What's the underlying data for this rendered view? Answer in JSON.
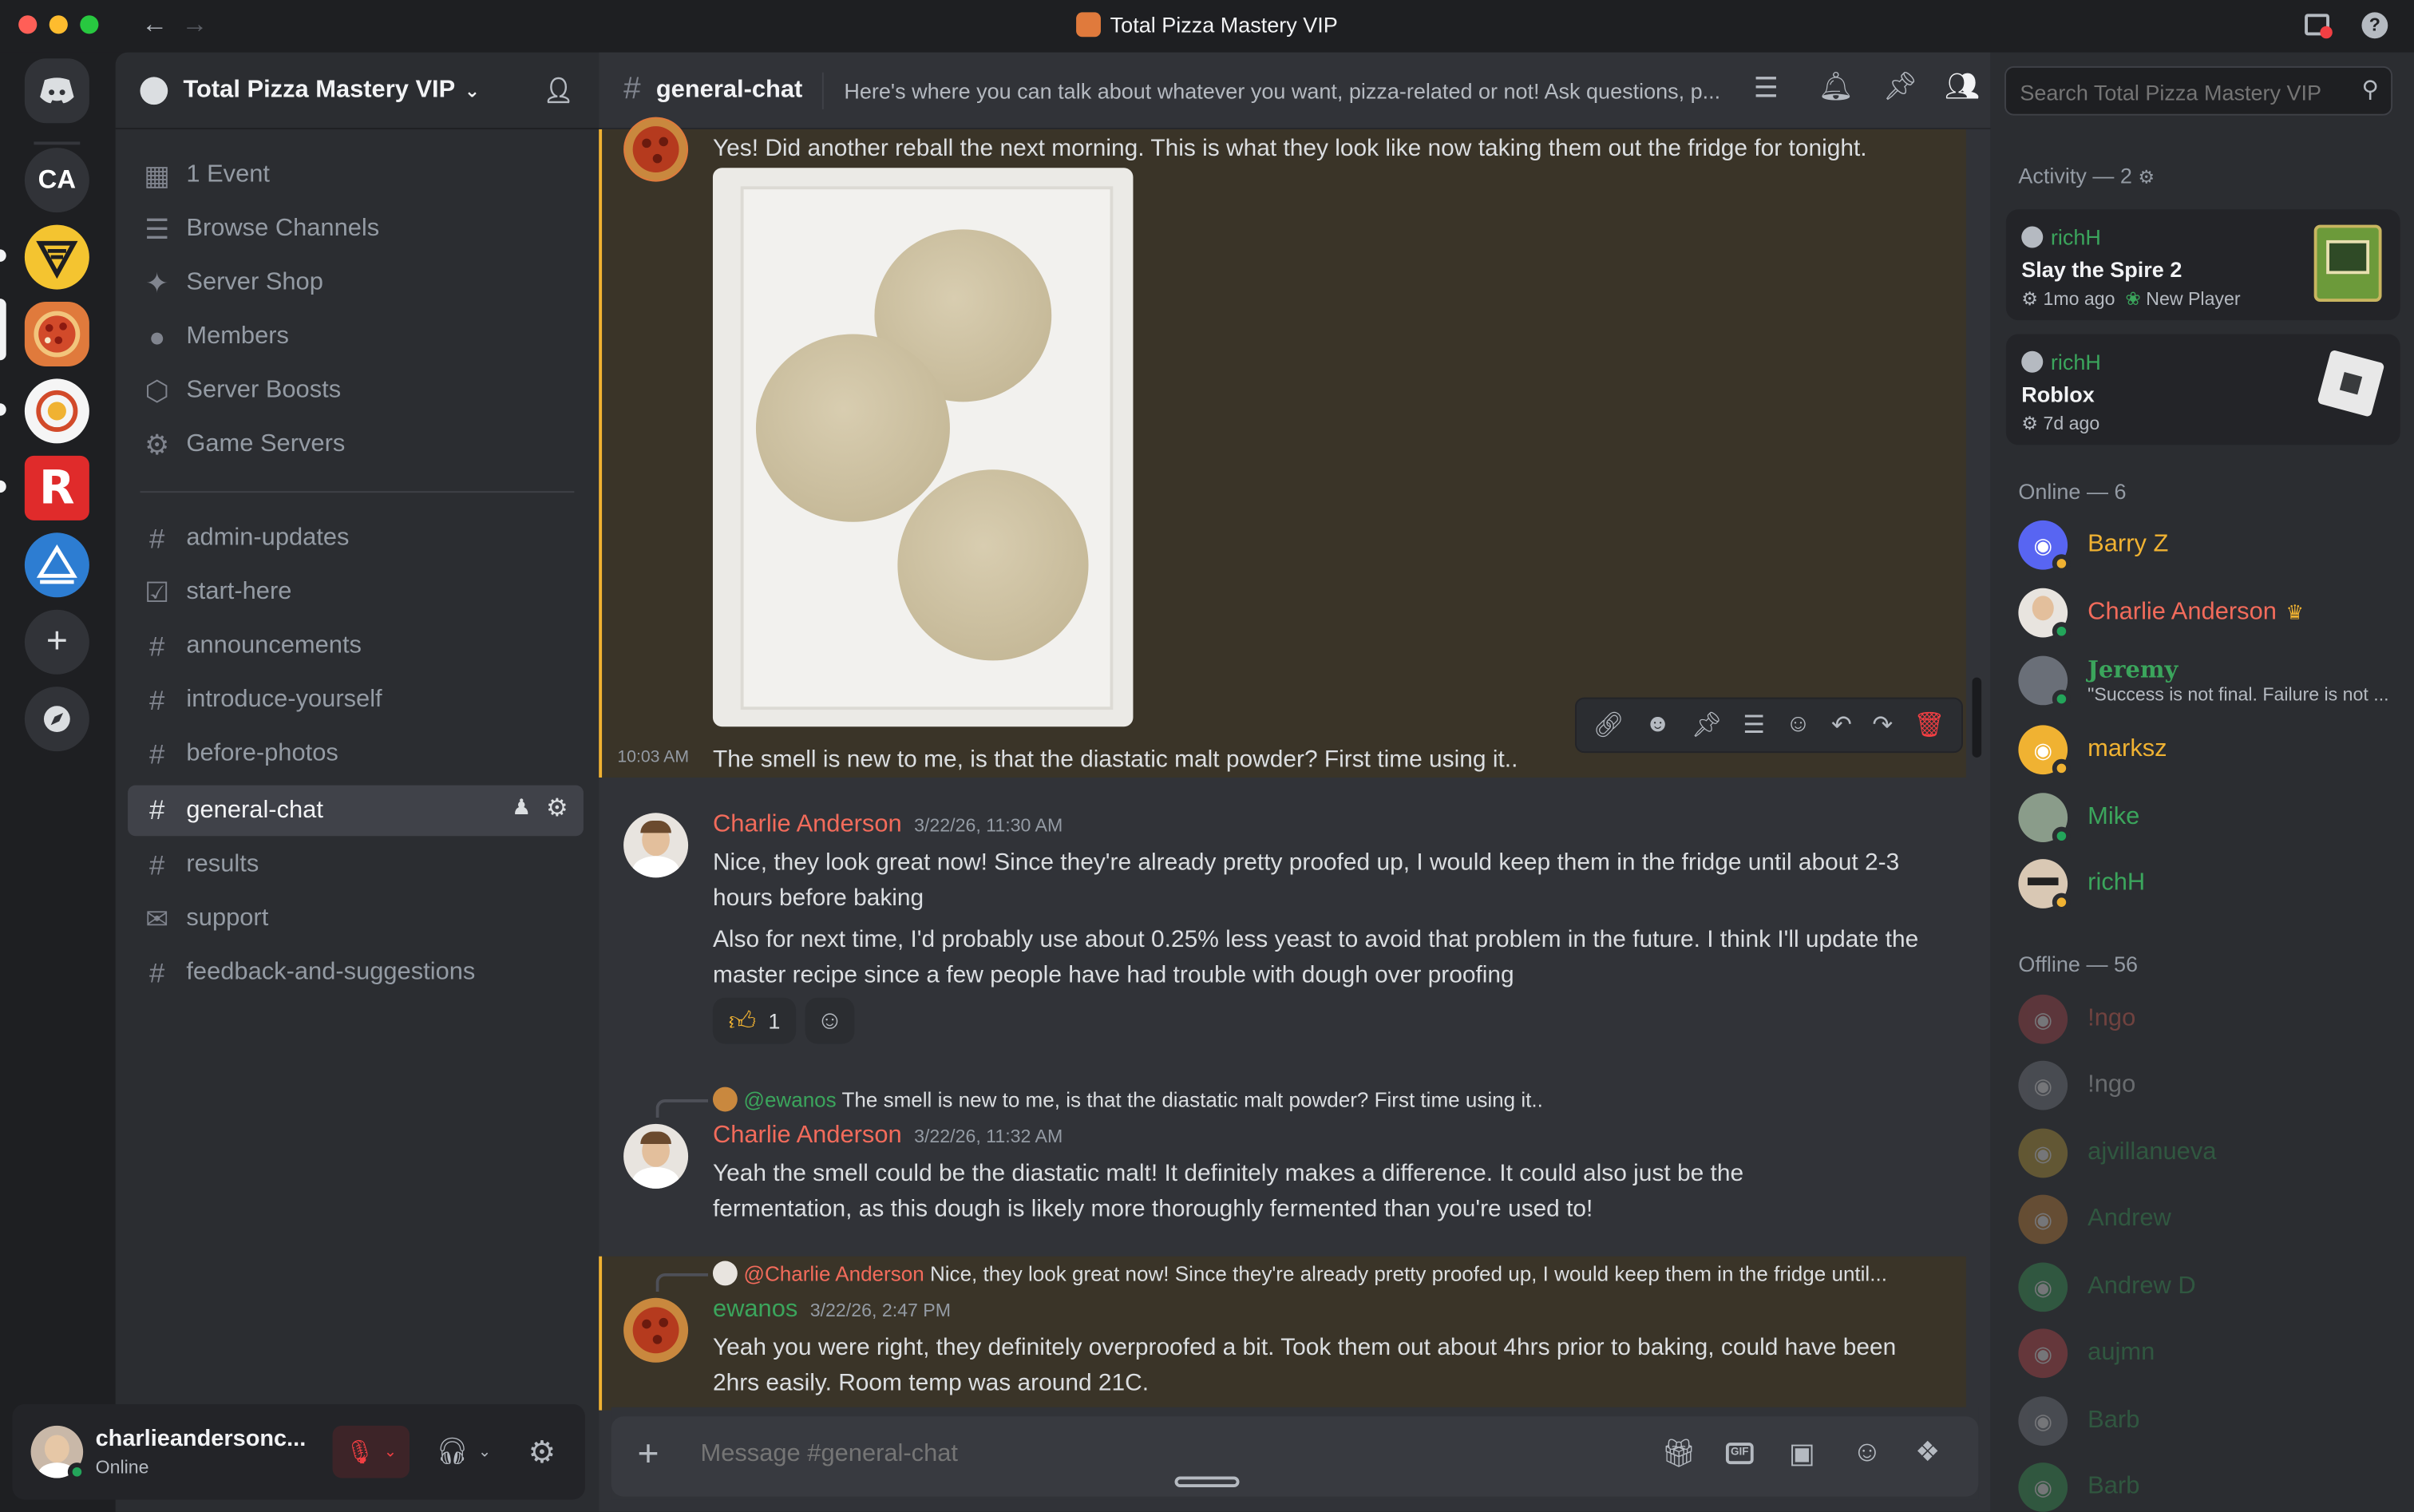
{
  "window": {
    "title": "Total Pizza Mastery VIP"
  },
  "servers": [
    {
      "name": "Discord",
      "label": ""
    },
    {
      "name": "CA",
      "label": "CA"
    },
    {
      "name": "server-3",
      "label": ""
    },
    {
      "name": "Total Pizza Mastery VIP",
      "label": ""
    },
    {
      "name": "server-5",
      "label": ""
    },
    {
      "name": "server-6",
      "label": "R"
    },
    {
      "name": "server-7",
      "label": ""
    }
  ],
  "server_header": {
    "title": "Total Pizza Mastery VIP"
  },
  "nav_items": [
    {
      "label": "1 Event",
      "icon": "calendar-icon"
    },
    {
      "label": "Browse Channels",
      "icon": "browse-icon"
    },
    {
      "label": "Server Shop",
      "icon": "shop-icon"
    },
    {
      "label": "Members",
      "icon": "members-icon"
    },
    {
      "label": "Server Boosts",
      "icon": "boost-icon"
    },
    {
      "label": "Game Servers",
      "icon": "gamepad-icon"
    }
  ],
  "channels": [
    {
      "label": "admin-updates"
    },
    {
      "label": "start-here"
    },
    {
      "label": "announcements"
    },
    {
      "label": "introduce-yourself"
    },
    {
      "label": "before-photos"
    },
    {
      "label": "general-chat"
    },
    {
      "label": "results"
    },
    {
      "label": "support"
    },
    {
      "label": "feedback-and-suggestions"
    }
  ],
  "user": {
    "name": "charlieandersonc...",
    "status": "Online"
  },
  "chat": {
    "channel": "general-chat",
    "topic": "Here's where you can talk about whatever you want, pizza-related or not! Ask questions, p...",
    "search_placeholder": "Search Total Pizza Mastery VIP",
    "composer_placeholder": "Message #general-chat"
  },
  "messages": [
    {
      "text": "Yes! Did another reball the next morning. This is what they look like now taking them out the fridge for tonight."
    },
    {
      "time": "10:03 AM",
      "text": "The smell is new to me, is that the diastatic malt powder? First time using it.."
    },
    {
      "author": "Charlie Anderson",
      "time": "3/22/26, 11:30 AM",
      "text1": "Nice, they look great now! Since they're already pretty proofed up, I would keep them in the fridge until about 2-3 hours before baking",
      "text2": "Also for next time, I'd probably use about 0.25% less yeast to avoid that problem in the future. I think I'll update the master recipe since a few people have had trouble with dough over proofing",
      "reaction_count": "1"
    },
    {
      "reply_user": "@ewanos",
      "reply_text": "The smell is new to me, is that the diastatic malt powder? First time using it..",
      "author": "Charlie Anderson",
      "time": "3/22/26, 11:32 AM",
      "text": "Yeah the smell could be the diastatic malt! It definitely makes a difference. It could also just be the fermentation, as this dough is likely more thoroughly fermented than you're used to!"
    },
    {
      "reply_user": "@Charlie Anderson",
      "reply_text": "Nice, they look great now! Since they're already pretty proofed up, I would keep them in the fridge until...",
      "author": "ewanos",
      "time": "3/22/26, 2:47 PM",
      "text": "Yeah you were right, they definitely overproofed a bit. Took them out about 4hrs prior to baking, could have been 2hrs easily. Room temp was around 21C."
    }
  ],
  "activity": {
    "header": "Activity — 2",
    "cards": [
      {
        "user": "richH",
        "game": "Slay the Spire 2",
        "time": "1mo ago",
        "extra": "New Player"
      },
      {
        "user": "richH",
        "game": "Roblox",
        "time": "7d ago",
        "extra": ""
      }
    ]
  },
  "online": {
    "header": "Online — 6",
    "members": [
      {
        "name": "Barry Z",
        "color": "#f0b232",
        "status": "idle",
        "sub": ""
      },
      {
        "name": "Charlie Anderson",
        "color": "#f26b5b",
        "status": "online",
        "sub": ""
      },
      {
        "name": "Jeremy",
        "color": "#3ba55c",
        "status": "online",
        "sub": "\"Success is not final. Failure is not ..."
      },
      {
        "name": "marksz",
        "color": "#f0b232",
        "status": "idle",
        "sub": ""
      },
      {
        "name": "Mike",
        "color": "#3ba55c",
        "status": "online",
        "sub": ""
      },
      {
        "name": "richH",
        "color": "#3ba55c",
        "status": "idle",
        "sub": ""
      }
    ]
  },
  "offline": {
    "header": "Offline — 56",
    "members": [
      {
        "name": "!ngo",
        "color": "#8a4a4e"
      },
      {
        "name": "!ngo",
        "color": "#55585f"
      },
      {
        "name": "ajvillanueva",
        "color": "#8a7a3e"
      },
      {
        "name": "Andrew",
        "color": "#8a6a3e"
      },
      {
        "name": "Andrew D",
        "color": "#3e7a4e"
      },
      {
        "name": "aujmn",
        "color": "#8a3e44"
      },
      {
        "name": "Barb",
        "color": "#55585f"
      },
      {
        "name": "Barb",
        "color": "#3e7a4e"
      }
    ]
  },
  "colors": {
    "accent": "#5865f2",
    "online": "#23a55a",
    "idle": "#f0b232",
    "danger": "#f23f43",
    "highlight": "#f0b232"
  }
}
